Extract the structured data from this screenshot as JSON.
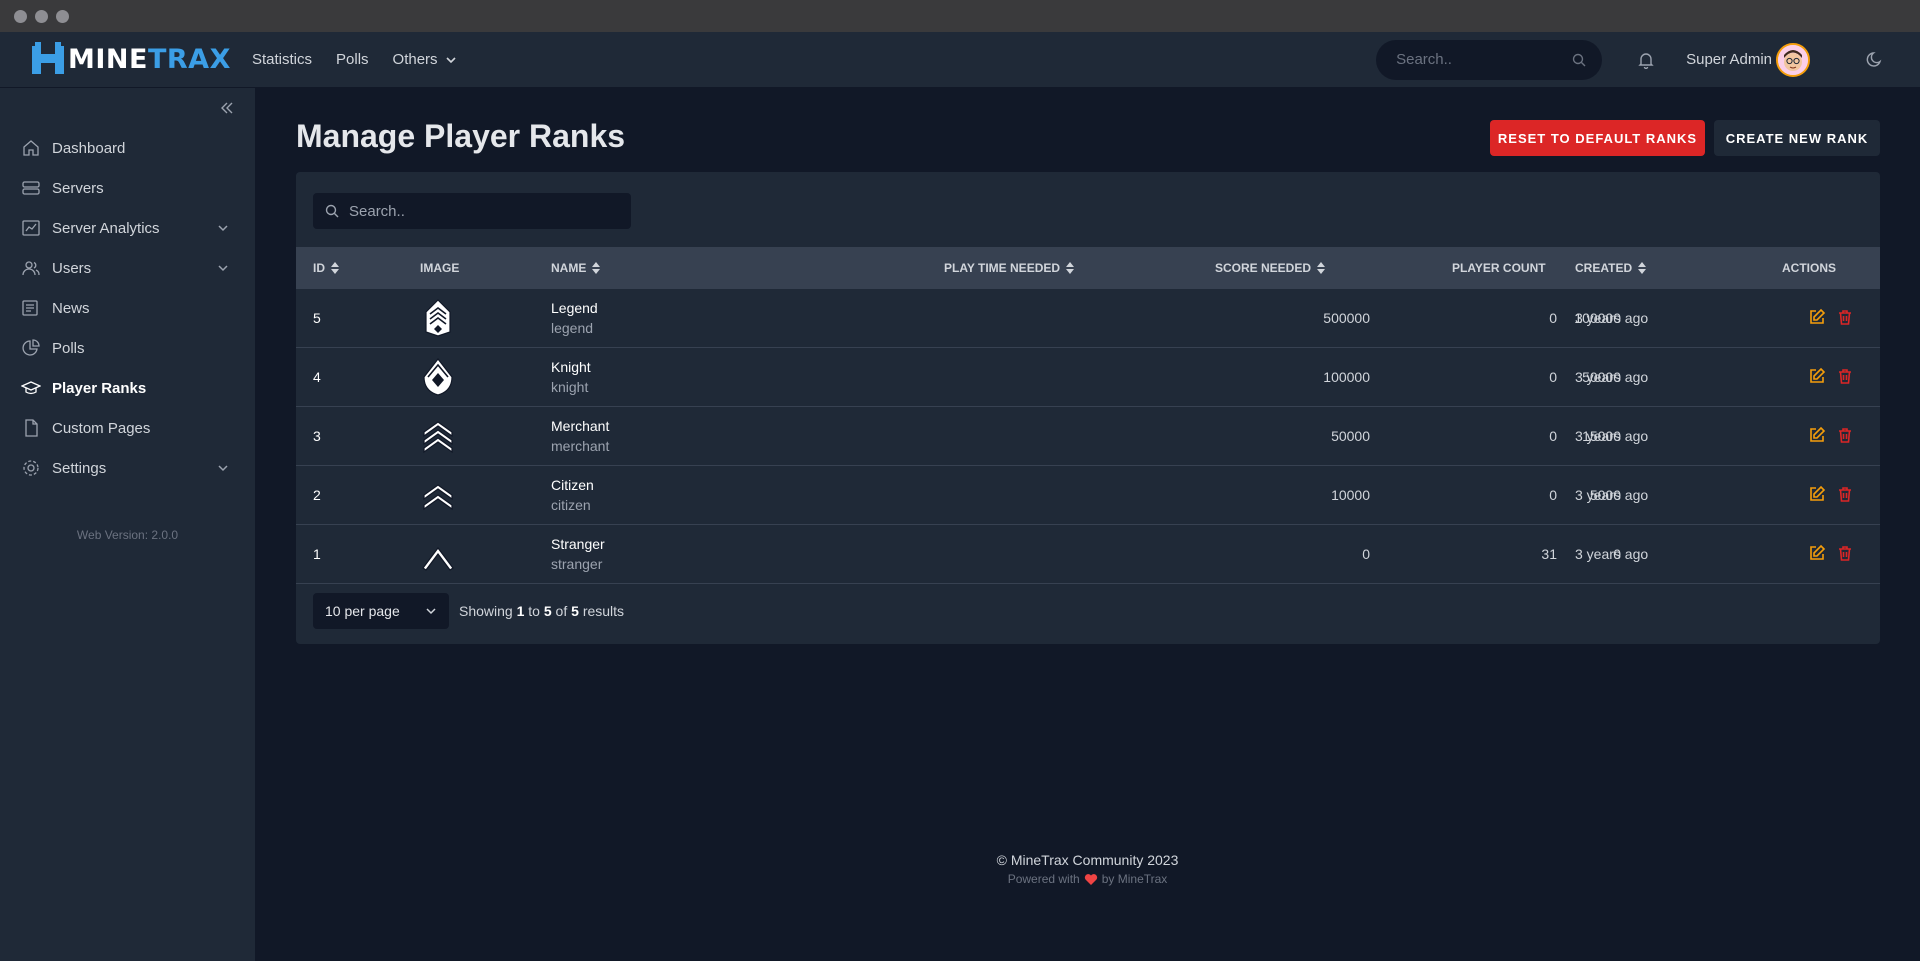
{
  "app": {
    "logo_part1": "MINE",
    "logo_part2": "TRAX",
    "brand_color": "#3b9ee6"
  },
  "topnav": {
    "links": [
      {
        "label": "Statistics"
      },
      {
        "label": "Polls"
      },
      {
        "label": "Others",
        "has_dropdown": true
      }
    ],
    "search_placeholder": "Search..",
    "user_name": "Super Admin",
    "icons": [
      "search-icon",
      "bell-icon",
      "moon-icon"
    ]
  },
  "sidebar": {
    "items": [
      {
        "label": "Dashboard",
        "icon": "home-icon"
      },
      {
        "label": "Servers",
        "icon": "server-icon"
      },
      {
        "label": "Server Analytics",
        "icon": "chart-icon",
        "expandable": true
      },
      {
        "label": "Users",
        "icon": "users-icon",
        "expandable": true
      },
      {
        "label": "News",
        "icon": "newspaper-icon"
      },
      {
        "label": "Polls",
        "icon": "pie-chart-icon"
      },
      {
        "label": "Player Ranks",
        "icon": "graduation-cap-icon",
        "active": true
      },
      {
        "label": "Custom Pages",
        "icon": "document-icon"
      },
      {
        "label": "Settings",
        "icon": "gear-icon",
        "expandable": true
      }
    ],
    "version": "Web Version: 2.0.0"
  },
  "page": {
    "title": "Manage Player Ranks",
    "reset_button": "Reset to default ranks",
    "create_button": "Create new rank"
  },
  "table": {
    "search_placeholder": "Search..",
    "columns": {
      "id": "ID",
      "image": "IMAGE",
      "name": "NAME",
      "play_time": "PLAY TIME NEEDED",
      "score": "SCORE NEEDED",
      "player_count": "PLAYER COUNT",
      "created": "CREATED",
      "actions": "ACTIONS"
    },
    "rows": [
      {
        "id": "5",
        "name": "Legend",
        "shortname": "legend",
        "play_time": "500000",
        "score": "100000",
        "player_count": "0",
        "created": "3 years ago",
        "badge": "legend"
      },
      {
        "id": "4",
        "name": "Knight",
        "shortname": "knight",
        "play_time": "100000",
        "score": "50000",
        "player_count": "0",
        "created": "3 years ago",
        "badge": "knight"
      },
      {
        "id": "3",
        "name": "Merchant",
        "shortname": "merchant",
        "play_time": "50000",
        "score": "15000",
        "player_count": "0",
        "created": "3 years ago",
        "badge": "merchant"
      },
      {
        "id": "2",
        "name": "Citizen",
        "shortname": "citizen",
        "play_time": "10000",
        "score": "5000",
        "player_count": "0",
        "created": "3 years ago",
        "badge": "citizen"
      },
      {
        "id": "1",
        "name": "Stranger",
        "shortname": "stranger",
        "play_time": "0",
        "score": "0",
        "player_count": "31",
        "created": "3 years ago",
        "badge": "stranger"
      }
    ],
    "per_page": "10 per page",
    "showing": {
      "prefix": "Showing",
      "from": "1",
      "to_word": "to",
      "to": "5",
      "of_word": "of",
      "total": "5",
      "suffix": "results"
    }
  },
  "footer": {
    "copyright": "© MineTrax Community 2023",
    "powered_prefix": "Powered with",
    "powered_suffix": "by MineTrax"
  },
  "colors": {
    "edit": "#f59e0b",
    "delete": "#dc2626",
    "reset_button": "#dc2626"
  }
}
